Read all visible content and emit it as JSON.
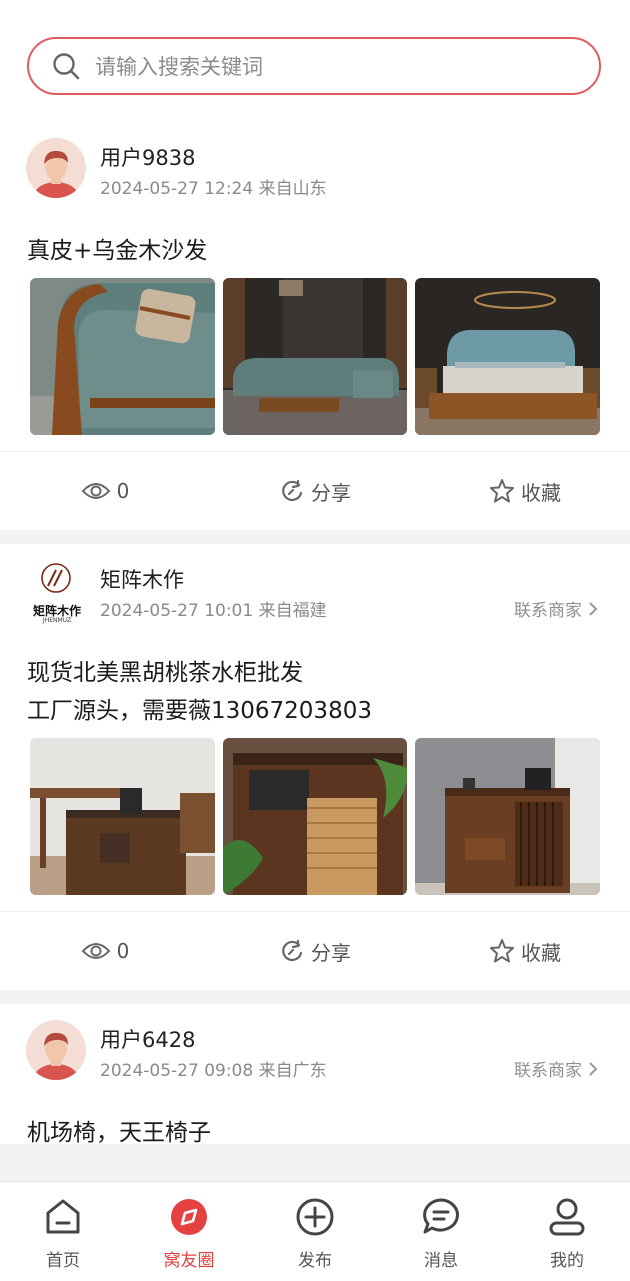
{
  "search": {
    "placeholder": "请输入搜索关键词"
  },
  "posts": [
    {
      "author": "用户9838",
      "meta": "2024-05-27 12:24 来自山东",
      "text": [
        "真皮+乌金木沙发"
      ],
      "views": "0",
      "share_label": "分享",
      "collect_label": "收藏"
    },
    {
      "author": "矩阵木作",
      "meta": "2024-05-27 10:01 来自福建",
      "contact_label": "联系商家",
      "logo_text": "矩阵木作",
      "logo_sub": "JHENMUZ",
      "text": [
        "现货北美黑胡桃茶水柜批发",
        "工厂源头，需要薇13067203803"
      ],
      "views": "0",
      "share_label": "分享",
      "collect_label": "收藏"
    },
    {
      "author": "用户6428",
      "meta": "2024-05-27 09:08 来自广东",
      "contact_label": "联系商家",
      "text": [
        "机场椅，天王椅子"
      ]
    }
  ],
  "tabbar": {
    "items": [
      {
        "label": "首页",
        "icon": "home-icon"
      },
      {
        "label": "窝友圈",
        "icon": "compass-icon",
        "active": true
      },
      {
        "label": "发布",
        "icon": "plus-circle-icon"
      },
      {
        "label": "消息",
        "icon": "message-icon"
      },
      {
        "label": "我的",
        "icon": "user-icon"
      }
    ]
  },
  "colors": {
    "accent": "#e64141",
    "search_border": "#e05a5f"
  }
}
